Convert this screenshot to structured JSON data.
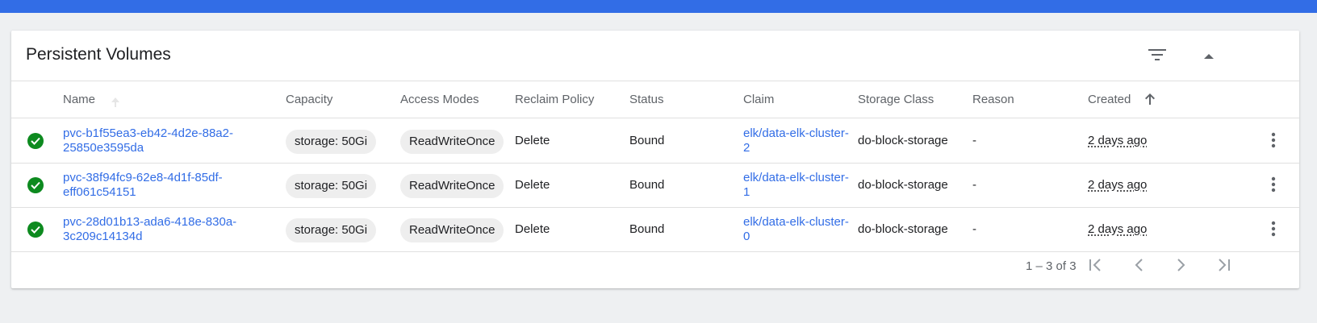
{
  "card": {
    "title": "Persistent Volumes",
    "filter_icon": "filter-list-icon",
    "collapse_icon": "arrow-drop-up-icon"
  },
  "columns": {
    "name": "Name",
    "capacity": "Capacity",
    "access_modes": "Access Modes",
    "reclaim_policy": "Reclaim Policy",
    "status": "Status",
    "claim": "Claim",
    "storage_class": "Storage Class",
    "reason": "Reason",
    "created": "Created"
  },
  "rows": [
    {
      "name_line1": "pvc-b1f55ea3-eb42-4d2e-88a2-",
      "name_line2": "25850e3595da",
      "capacity": "storage: 50Gi",
      "access_modes": "ReadWriteOnce",
      "reclaim_policy": "Delete",
      "status": "Bound",
      "claim_line1": "elk/data-elk-cluster-",
      "claim_line2": "2",
      "storage_class": "do-block-storage",
      "reason": "-",
      "created": "2 days ago"
    },
    {
      "name_line1": "pvc-38f94fc9-62e8-4d1f-85df-",
      "name_line2": "eff061c54151",
      "capacity": "storage: 50Gi",
      "access_modes": "ReadWriteOnce",
      "reclaim_policy": "Delete",
      "status": "Bound",
      "claim_line1": "elk/data-elk-cluster-",
      "claim_line2": "1",
      "storage_class": "do-block-storage",
      "reason": "-",
      "created": "2 days ago"
    },
    {
      "name_line1": "pvc-28d01b13-ada6-418e-830a-",
      "name_line2": "3c209c14134d",
      "capacity": "storage: 50Gi",
      "access_modes": "ReadWriteOnce",
      "reclaim_policy": "Delete",
      "status": "Bound",
      "claim_line1": "elk/data-elk-cluster-",
      "claim_line2": "0",
      "storage_class": "do-block-storage",
      "reason": "-",
      "created": "2 days ago"
    }
  ],
  "pagination": {
    "range_label": "1 – 3 of 3"
  },
  "colors": {
    "accent": "#326de6",
    "status_ok": "#0d8a1f"
  }
}
